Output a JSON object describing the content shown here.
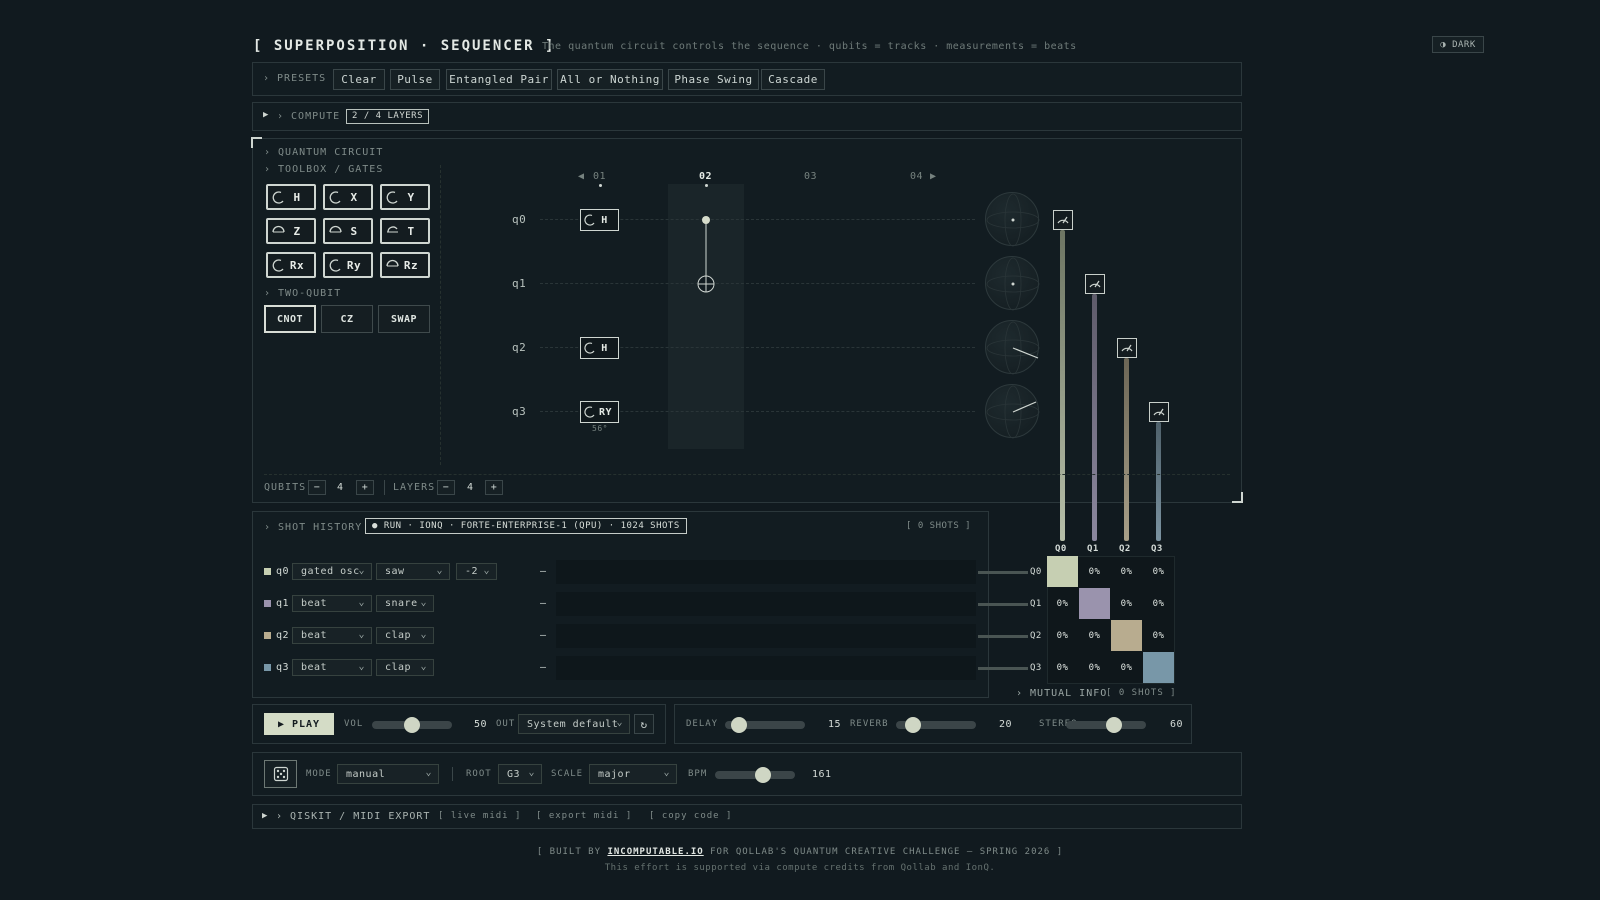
{
  "header": {
    "title": "[ SUPERPOSITION · SEQUENCER ]",
    "subtitle": "The quantum circuit controls the sequence · qubits = tracks · measurements = beats",
    "theme_label": "◑ DARK"
  },
  "presets": {
    "label": "› PRESETS",
    "items": [
      "Clear",
      "Pulse",
      "Entangled Pair",
      "All or Nothing",
      "Phase Swing",
      "Cascade"
    ]
  },
  "compute": {
    "label": "› COMPUTE",
    "badge": "2 / 4 LAYERS",
    "toggle": "▶"
  },
  "circuit": {
    "section_label": "› QUANTUM CIRCUIT",
    "toolbox_label": "› TOOLBOX / GATES",
    "single_gates": [
      "H",
      "X",
      "Y",
      "Z",
      "S",
      "T",
      "Rx",
      "Ry",
      "Rz"
    ],
    "two_qubit_label": "› TWO-QUBIT",
    "two_qubit_gates": [
      "CNOT",
      "CZ",
      "SWAP"
    ],
    "columns": [
      "01",
      "02",
      "03",
      "04"
    ],
    "col_prev": "◀",
    "col_next": "▶",
    "qubits": [
      "q0",
      "q1",
      "q2",
      "q3"
    ],
    "placed": {
      "q0_gate": "H",
      "q2_gate": "H",
      "q3_gate": "RY",
      "q3_angle": "56°"
    },
    "qubits_label": "QUBITS",
    "qubits_count": "4",
    "layers_label": "LAYERS",
    "layers_count": "4",
    "minus": "−",
    "plus": "+"
  },
  "shot_history": {
    "label": "› SHOT HISTORY",
    "run_badge": "● RUN · IONQ · FORTE-ENTERPRISE-1 (QPU) · 1024 SHOTS",
    "shots": "[ 0 SHOTS ]",
    "tracks": [
      {
        "name": "q0",
        "instrument": "gated osc",
        "sound": "saw",
        "octave": "-2",
        "dash": "—",
        "out": "Q0",
        "color": "#c6cfb2"
      },
      {
        "name": "q1",
        "instrument": "beat",
        "sound": "snare",
        "dash": "—",
        "out": "Q1",
        "color": "#9a93ad"
      },
      {
        "name": "q2",
        "instrument": "beat",
        "sound": "clap",
        "dash": "—",
        "out": "Q2",
        "color": "#b8ac8f"
      },
      {
        "name": "q3",
        "instrument": "beat",
        "sound": "clap",
        "dash": "—",
        "out": "Q3",
        "color": "#7897a8"
      }
    ]
  },
  "matrix": {
    "col_headers": [
      "Q0",
      "Q1",
      "Q2",
      "Q3"
    ],
    "rows": [
      [
        "",
        "0%",
        "0%",
        "0%"
      ],
      [
        "0%",
        "",
        "0%",
        "0%"
      ],
      [
        "0%",
        "0%",
        "",
        "0%"
      ],
      [
        "0%",
        "0%",
        "0%",
        ""
      ]
    ],
    "mutual_info": "› MUTUAL INFO",
    "mutual_shots": "[ 0 SHOTS ]"
  },
  "transport": {
    "play": "▶ PLAY",
    "vol_label": "VOL",
    "vol_value": "50",
    "out_label": "OUT",
    "out_value": "System default",
    "refresh": "↻"
  },
  "effects": {
    "delay_label": "DELAY",
    "delay_value": "15",
    "reverb_label": "REVERB",
    "reverb_value": "20",
    "stereo_label": "STEREO",
    "stereo_value": "60"
  },
  "settings": {
    "mode_label": "MODE",
    "mode_value": "manual",
    "root_label": "ROOT",
    "root_value": "G3",
    "scale_label": "SCALE",
    "scale_value": "major",
    "bpm_label": "BPM",
    "bpm_value": "161"
  },
  "export": {
    "toggle": "▶",
    "label": "› QISKIT / MIDI EXPORT",
    "live_midi": "[ live midi ]",
    "export_midi": "[ export midi ]",
    "copy_code": "[ copy code ]"
  },
  "footer": {
    "line1_prefix": "[ BUILT BY",
    "link": "INCOMPUTABLE.IO",
    "line1_suffix": "FOR QOLLAB'S QUANTUM CREATIVE CHALLENGE — SPRING 2026 ]",
    "line2": "This effort is supported via compute credits from Qollab and IonQ."
  }
}
